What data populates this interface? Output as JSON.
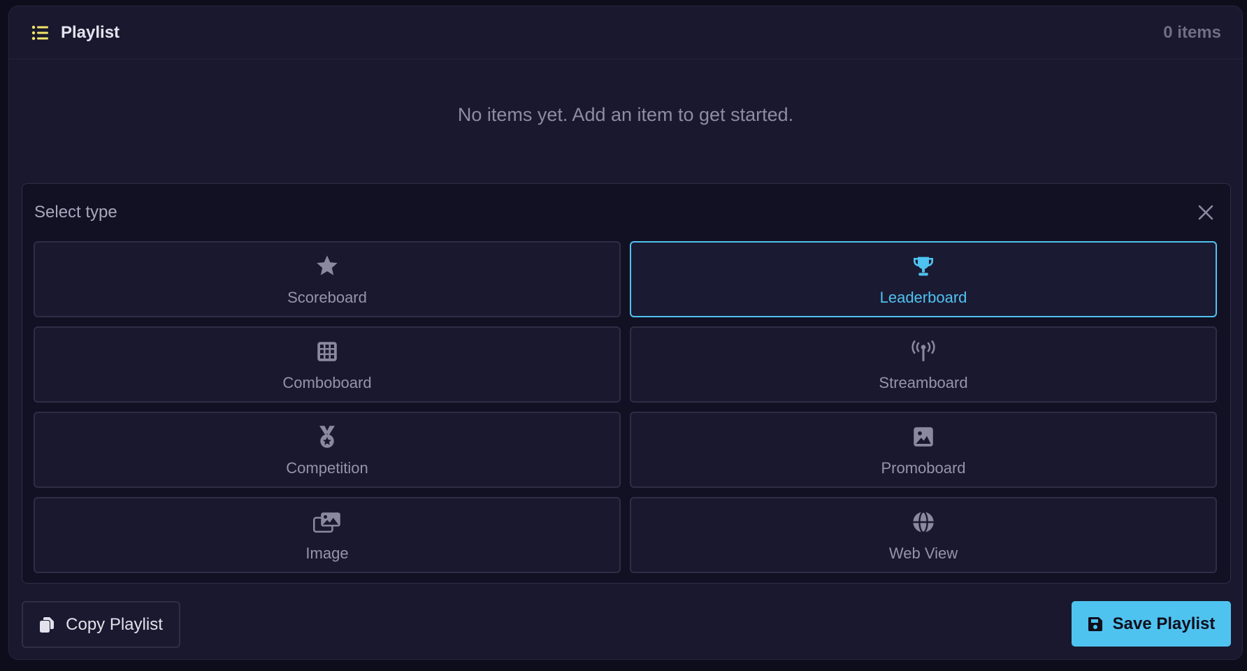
{
  "header": {
    "title": "Playlist",
    "count": "0 items",
    "icon": "list-icon"
  },
  "empty_message": "No items yet. Add an item to get started.",
  "type_selector": {
    "title": "Select type",
    "close_icon": "close-icon",
    "options": [
      {
        "label": "Scoreboard",
        "icon": "star-icon",
        "selected": false
      },
      {
        "label": "Leaderboard",
        "icon": "trophy-icon",
        "selected": true
      },
      {
        "label": "Comboboard",
        "icon": "grid-icon",
        "selected": false
      },
      {
        "label": "Streamboard",
        "icon": "broadcast-tower-icon",
        "selected": false
      },
      {
        "label": "Competition",
        "icon": "medal-icon",
        "selected": false
      },
      {
        "label": "Promoboard",
        "icon": "image-icon",
        "selected": false
      },
      {
        "label": "Image",
        "icon": "images-icon",
        "selected": false
      },
      {
        "label": "Web View",
        "icon": "globe-icon",
        "selected": false
      }
    ]
  },
  "footer": {
    "copy_label": "Copy Playlist",
    "save_label": "Save Playlist"
  },
  "colors": {
    "accent": "#4fc3ef",
    "header_icon": "#f3e36a",
    "background": "#19182e"
  }
}
